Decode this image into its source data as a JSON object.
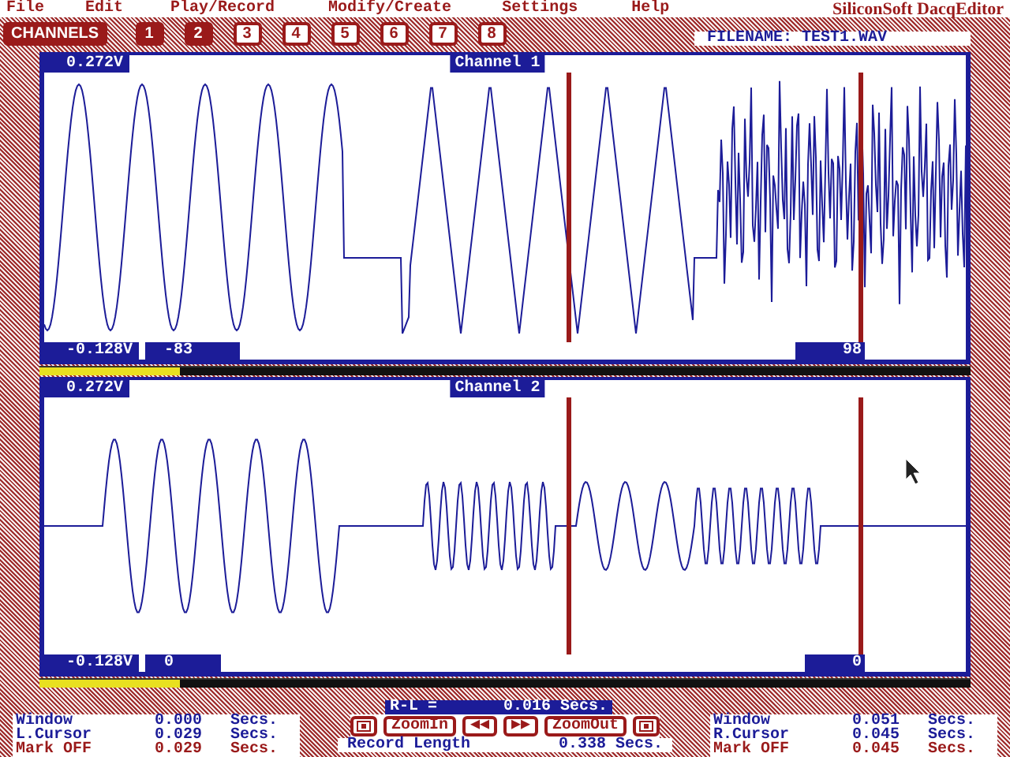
{
  "menu": [
    {
      "label": "File"
    },
    {
      "label": "Edit"
    },
    {
      "label": "Play/Record"
    },
    {
      "label": "Modify/Create"
    },
    {
      "label": "Settings"
    },
    {
      "label": "Help"
    }
  ],
  "app_title": "SiliconSoft DacqEditor",
  "channels_button": "CHANNELS",
  "channel_buttons": [
    {
      "label": "1",
      "selected": true
    },
    {
      "label": "2",
      "selected": true
    },
    {
      "label": "3",
      "selected": false
    },
    {
      "label": "4",
      "selected": false
    },
    {
      "label": "5",
      "selected": false
    },
    {
      "label": "6",
      "selected": false
    },
    {
      "label": "7",
      "selected": false
    },
    {
      "label": "8",
      "selected": false
    }
  ],
  "filename": "FILENAME: TEST1.WAV",
  "panels": [
    {
      "title": "Channel 1",
      "top_voltage": "0.272V",
      "bottom_voltage": "-0.128V",
      "left_marker": "-83",
      "right_marker": "98",
      "scroll": {
        "level": 0.15
      }
    },
    {
      "title": "Channel 2",
      "top_voltage": "0.272V",
      "bottom_voltage": "-0.128V",
      "left_marker": "0",
      "right_marker": "0",
      "scroll": {
        "level": 0.15
      }
    }
  ],
  "difference": {
    "label": "R-L =",
    "value": "0.016 Secs."
  },
  "left_info": [
    {
      "label": "Window",
      "value": "0.000",
      "unit": "Secs.",
      "kind": "plain"
    },
    {
      "label": "L.Cursor",
      "value": "0.029",
      "unit": "Secs.",
      "kind": "plain"
    },
    {
      "label": "Mark OFF",
      "value": "0.029",
      "unit": "Secs.",
      "kind": "mark"
    }
  ],
  "controls": [
    {
      "kind": "icon"
    },
    {
      "kind": "text",
      "label": "ZoomIn"
    },
    {
      "kind": "text",
      "label": "◀◀"
    },
    {
      "kind": "text",
      "label": "▶▶"
    },
    {
      "kind": "text",
      "label": "ZoomOut"
    },
    {
      "kind": "icon"
    }
  ],
  "record_length": {
    "label": "Record Length",
    "value": "0.338 Secs."
  },
  "right_info": [
    {
      "label": "Window",
      "value": "0.051",
      "unit": "Secs.",
      "kind": "plain"
    },
    {
      "label": "R.Cursor",
      "value": "0.045",
      "unit": "Secs.",
      "kind": "plain"
    },
    {
      "label": "Mark OFF",
      "value": "0.045",
      "unit": "Secs.",
      "kind": "mark"
    }
  ]
}
